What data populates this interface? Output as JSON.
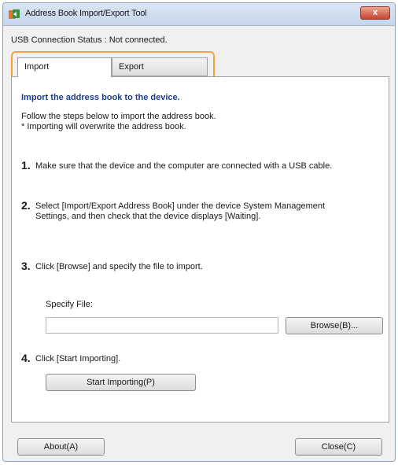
{
  "window": {
    "title": "Address Book Import/Export Tool",
    "close_label": "x",
    "status_text": "USB Connection Status : Not connected."
  },
  "tabs": [
    {
      "label": "Import",
      "active": true
    },
    {
      "label": "Export",
      "active": false
    }
  ],
  "import_panel": {
    "heading": "Import the address book to the device.",
    "intro_line1": "Follow the steps below to import the address book.",
    "intro_line2": "* Importing will overwrite the address book.",
    "steps": [
      {
        "num": "1.",
        "text_line1": "Make sure that the device and the computer are connected with a USB cable.",
        "text_line2": ""
      },
      {
        "num": "2.",
        "text_line1": "Select [Import/Export Address Book] under the device System Management",
        "text_line2": "Settings, and then check that the device displays [Waiting]."
      },
      {
        "num": "3.",
        "text_line1": "Click [Browse] and specify the file to import.",
        "text_line2": ""
      },
      {
        "num": "4.",
        "text_line1": "Click [Start Importing].",
        "text_line2": ""
      }
    ],
    "specify_file_label": "Specify File:",
    "file_value": "",
    "browse_label": "Browse(B)...",
    "start_importing_label": "Start Importing(P)"
  },
  "footer": {
    "about_label": "About(A)",
    "close_label": "Close(C)"
  },
  "colors": {
    "highlight": "#f2a33a",
    "heading": "#1b3f8a"
  }
}
